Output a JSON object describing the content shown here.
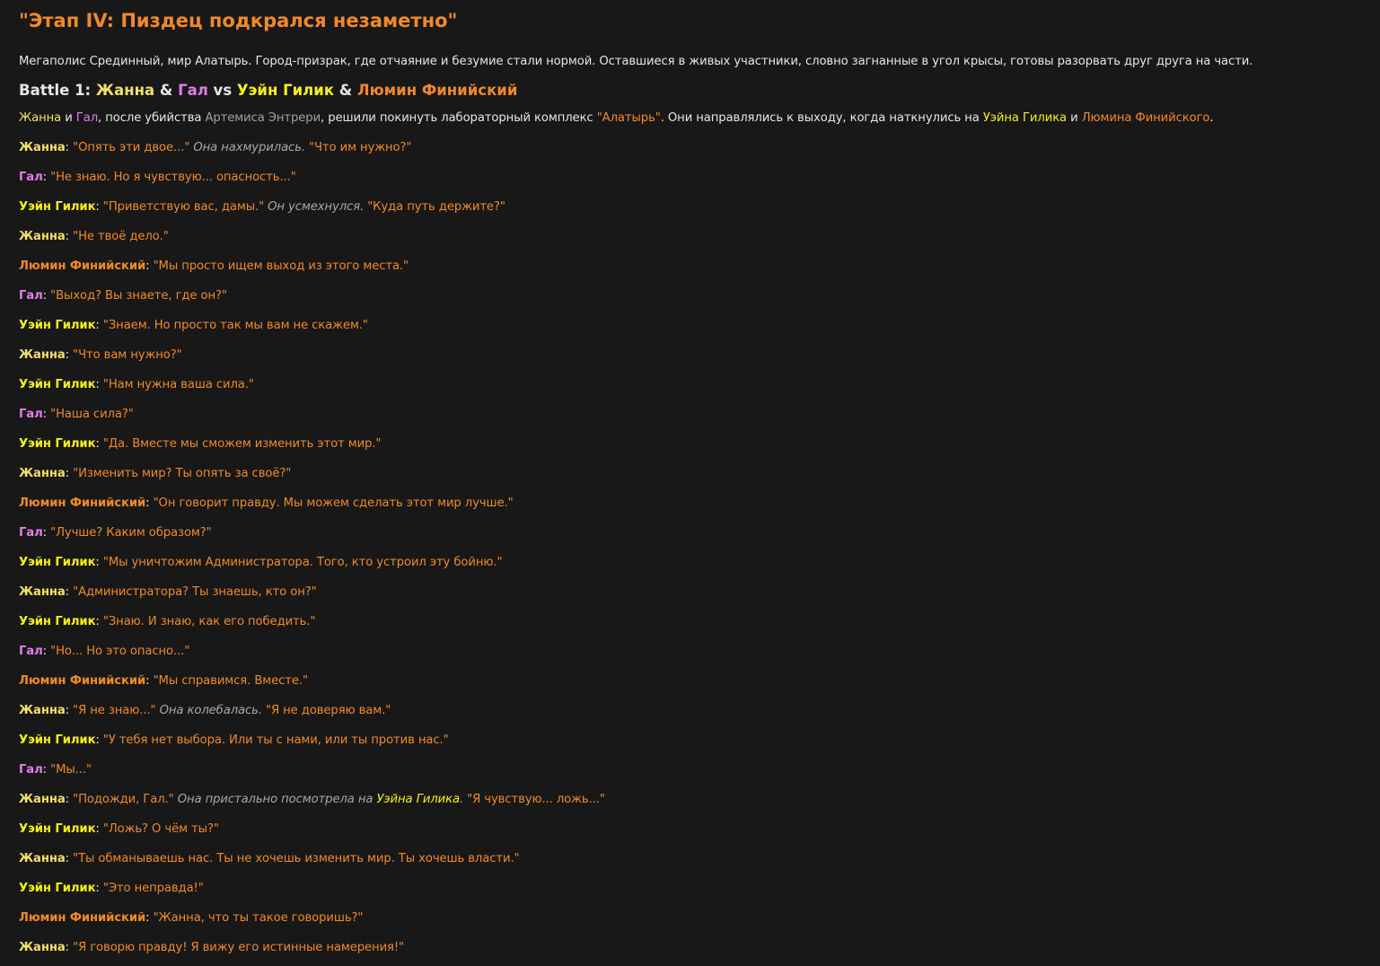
{
  "title": "\"Этап IV: Пиздец подкрался незаметно\"",
  "intro": "Мегаполис Срединный, мир Алатырь. Город-призрак, где отчаяние и безумие стали нормой. Оставшиеся в живых участники, словно загнанные в угол крысы, готовы разорвать друг друга на части.",
  "battle": {
    "prefix": "Battle 1: ",
    "fighter1": "Жанна",
    "amp1": " & ",
    "fighter2": "Гал",
    "vs": " vs ",
    "fighter3": "Уэйн Гилик",
    "amp2": " & ",
    "fighter4": "Люмин Финийский"
  },
  "narration": {
    "zhanna": "Жанна",
    "t1": " и ",
    "gal": "Гал",
    "t2": ", после убийства ",
    "artemis": "Артемиса Энтрери",
    "t3": ", решили покинуть лабораторный комплекс ",
    "place": "\"Алатырь\"",
    "t4": ". Они направлялись к выходу, когда наткнулись на ",
    "wayne": "Уэйна Гилика",
    "t5": " и ",
    "lumin": "Люмина Финийского",
    "t6": "."
  },
  "colors": {
    "background": "#181818",
    "title": "#f0892c",
    "zhanna": "#f2df6b",
    "gal": "#e27ee8",
    "wayne": "#f5f01c",
    "lumin": "#f0892c",
    "quote": "#f0892c",
    "action": "#a8a8a8"
  },
  "lines": [
    {
      "speaker": "Жанна",
      "cls": "zhanna",
      "parts": [
        {
          "t": "q",
          "v": "\"Опять эти двое...\""
        },
        {
          "t": "q",
          "v": " "
        },
        {
          "t": "act",
          "v": "Она нахмурилась."
        },
        {
          "t": "q",
          "v": " \"Что им нужно?\""
        }
      ]
    },
    {
      "speaker": "Гал",
      "cls": "gal",
      "parts": [
        {
          "t": "q",
          "v": "\"Не знаю. Но я чувствую... опасность...\""
        }
      ]
    },
    {
      "speaker": "Уэйн Гилик",
      "cls": "wayne",
      "parts": [
        {
          "t": "q",
          "v": "\"Приветствую вас, дамы.\""
        },
        {
          "t": "q",
          "v": " "
        },
        {
          "t": "act",
          "v": "Он усмехнулся."
        },
        {
          "t": "q",
          "v": " \"Куда путь держите?\""
        }
      ]
    },
    {
      "speaker": "Жанна",
      "cls": "zhanna",
      "parts": [
        {
          "t": "q",
          "v": "\"Не твоё дело.\""
        }
      ]
    },
    {
      "speaker": "Люмин Финийский",
      "cls": "lumin",
      "parts": [
        {
          "t": "q",
          "v": "\"Мы просто ищем выход из этого места.\""
        }
      ]
    },
    {
      "speaker": "Гал",
      "cls": "gal",
      "parts": [
        {
          "t": "q",
          "v": "\"Выход? Вы знаете, где он?\""
        }
      ]
    },
    {
      "speaker": "Уэйн Гилик",
      "cls": "wayne",
      "parts": [
        {
          "t": "q",
          "v": "\"Знаем. Но просто так мы вам не скажем.\""
        }
      ]
    },
    {
      "speaker": "Жанна",
      "cls": "zhanna",
      "parts": [
        {
          "t": "q",
          "v": "\"Что вам нужно?\""
        }
      ]
    },
    {
      "speaker": "Уэйн Гилик",
      "cls": "wayne",
      "parts": [
        {
          "t": "q",
          "v": "\"Нам нужна ваша сила.\""
        }
      ]
    },
    {
      "speaker": "Гал",
      "cls": "gal",
      "parts": [
        {
          "t": "q",
          "v": "\"Наша сила?\""
        }
      ]
    },
    {
      "speaker": "Уэйн Гилик",
      "cls": "wayne",
      "parts": [
        {
          "t": "q",
          "v": "\"Да. Вместе мы сможем изменить этот мир.\""
        }
      ]
    },
    {
      "speaker": "Жанна",
      "cls": "zhanna",
      "parts": [
        {
          "t": "q",
          "v": "\"Изменить мир? Ты опять за своё?\""
        }
      ]
    },
    {
      "speaker": "Люмин Финийский",
      "cls": "lumin",
      "parts": [
        {
          "t": "q",
          "v": "\"Он говорит правду. Мы можем сделать этот мир лучше.\""
        }
      ]
    },
    {
      "speaker": "Гал",
      "cls": "gal",
      "parts": [
        {
          "t": "q",
          "v": "\"Лучше? Каким образом?\""
        }
      ]
    },
    {
      "speaker": "Уэйн Гилик",
      "cls": "wayne",
      "parts": [
        {
          "t": "q",
          "v": "\"Мы уничтожим Администратора. Того, кто устроил эту бойню.\""
        }
      ]
    },
    {
      "speaker": "Жанна",
      "cls": "zhanna",
      "parts": [
        {
          "t": "q",
          "v": "\"Администратора? Ты знаешь, кто он?\""
        }
      ]
    },
    {
      "speaker": "Уэйн Гилик",
      "cls": "wayne",
      "parts": [
        {
          "t": "q",
          "v": "\"Знаю. И знаю, как его победить.\""
        }
      ]
    },
    {
      "speaker": "Гал",
      "cls": "gal",
      "parts": [
        {
          "t": "q",
          "v": "\"Но... Но это опасно...\""
        }
      ]
    },
    {
      "speaker": "Люмин Финийский",
      "cls": "lumin",
      "parts": [
        {
          "t": "q",
          "v": "\"Мы справимся. Вместе.\""
        }
      ]
    },
    {
      "speaker": "Жанна",
      "cls": "zhanna",
      "parts": [
        {
          "t": "q",
          "v": "\"Я не знаю...\""
        },
        {
          "t": "q",
          "v": " "
        },
        {
          "t": "act",
          "v": "Она колебалась."
        },
        {
          "t": "q",
          "v": " \"Я не доверяю вам.\""
        }
      ]
    },
    {
      "speaker": "Уэйн Гилик",
      "cls": "wayne",
      "parts": [
        {
          "t": "q",
          "v": "\"У тебя нет выбора. Или ты с нами, или ты против нас.\""
        }
      ]
    },
    {
      "speaker": "Гал",
      "cls": "gal",
      "parts": [
        {
          "t": "q",
          "v": "\"Мы...\""
        }
      ]
    },
    {
      "speaker": "Жанна",
      "cls": "zhanna",
      "parts": [
        {
          "t": "q",
          "v": "\"Подожди, Гал.\""
        },
        {
          "t": "q",
          "v": " "
        },
        {
          "t": "act",
          "v": "Она пристально посмотрела на "
        },
        {
          "t": "act-name",
          "v": "Уэйна Гилика"
        },
        {
          "t": "act",
          "v": "."
        },
        {
          "t": "q",
          "v": " \"Я чувствую... ложь...\""
        }
      ]
    },
    {
      "speaker": "Уэйн Гилик",
      "cls": "wayne",
      "parts": [
        {
          "t": "q",
          "v": "\"Ложь? О чём ты?\""
        }
      ]
    },
    {
      "speaker": "Жанна",
      "cls": "zhanna",
      "parts": [
        {
          "t": "q",
          "v": "\"Ты обманываешь нас. Ты не хочешь изменить мир. Ты хочешь власти.\""
        }
      ]
    },
    {
      "speaker": "Уэйн Гилик",
      "cls": "wayne",
      "parts": [
        {
          "t": "q",
          "v": "\"Это неправда!\""
        }
      ]
    },
    {
      "speaker": "Люмин Финийский",
      "cls": "lumin",
      "parts": [
        {
          "t": "q",
          "v": "\"Жанна, что ты такое говоришь?\""
        }
      ]
    },
    {
      "speaker": "Жанна",
      "cls": "zhanna",
      "parts": [
        {
          "t": "q",
          "v": "\"Я говорю правду! Я вижу его истинные намерения!\""
        }
      ]
    }
  ]
}
